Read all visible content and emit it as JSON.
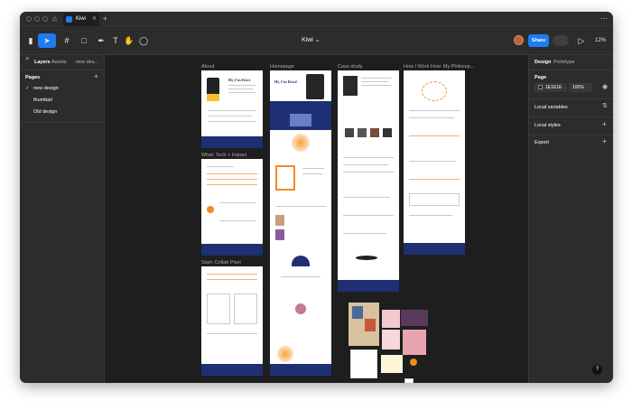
{
  "tab": {
    "title": "Kiwi"
  },
  "toolbar": {
    "doc_title": "Kiwi",
    "share_label": "Share",
    "zoom": "12%"
  },
  "left_panel": {
    "tabs": [
      "Layers",
      "Assets",
      "new des..."
    ],
    "pages_title": "Pages",
    "pages": [
      {
        "label": "new design",
        "selected": true
      },
      {
        "label": "thumbail",
        "selected": false
      },
      {
        "label": "Old design",
        "selected": false
      }
    ]
  },
  "right_panel": {
    "tabs": [
      "Design",
      "Prototype"
    ],
    "page_title": "Page",
    "background_hex": "1E1E1E",
    "opacity": "100%",
    "sections": [
      "Local variables",
      "Local styles",
      "Export"
    ]
  },
  "canvas": {
    "frames": [
      {
        "label": "About",
        "heading": "Hi, I'm Kiwi"
      },
      {
        "label": "Homepage",
        "heading": "Hi, I'm Kiwi!"
      },
      {
        "label": "Case study"
      },
      {
        "label": "How I Work How: My Philosop..."
      },
      {
        "label": "What: Tech + Impact"
      },
      {
        "label": "Start: Collab Pixel"
      }
    ]
  },
  "colors": {
    "accent": "#1d7cf2",
    "navy": "#1f2f73",
    "orange": "#f28a1e"
  }
}
